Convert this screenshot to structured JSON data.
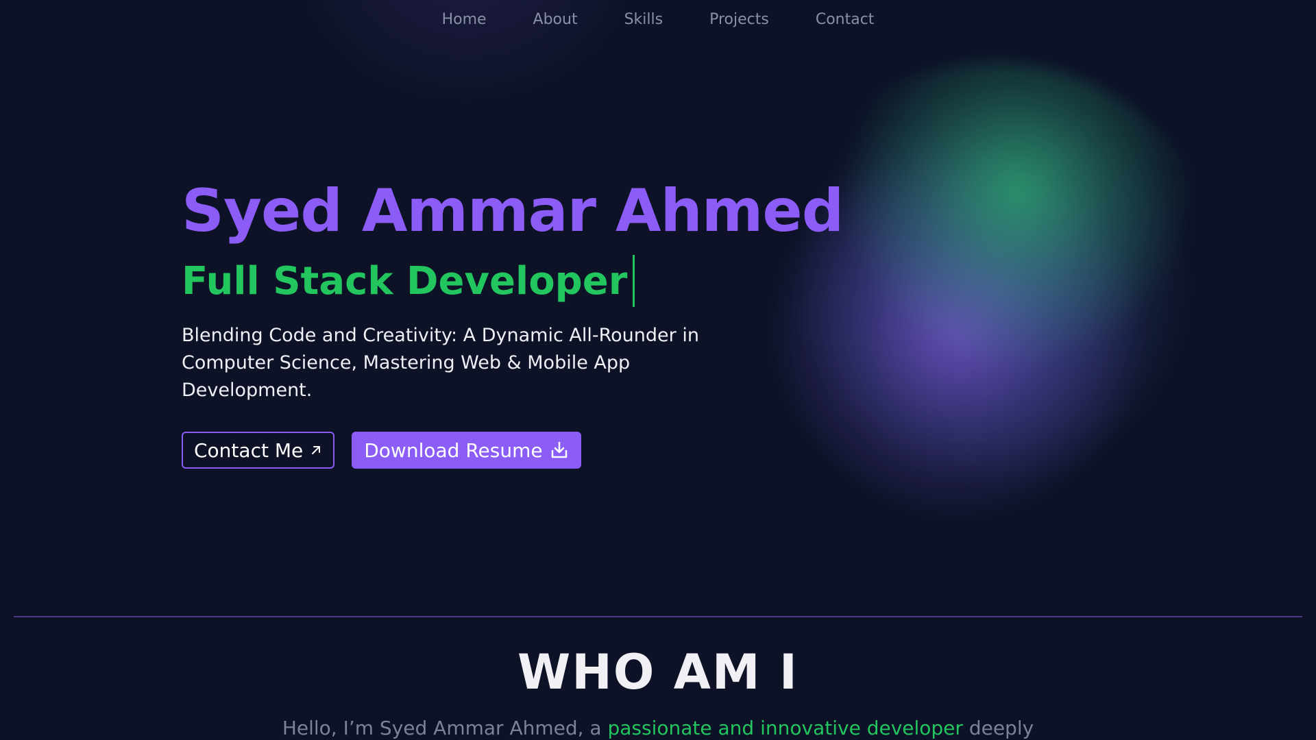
{
  "nav": {
    "items": [
      {
        "label": "Home"
      },
      {
        "label": "About"
      },
      {
        "label": "Skills"
      },
      {
        "label": "Projects"
      },
      {
        "label": "Contact"
      }
    ]
  },
  "hero": {
    "name": "Syed Ammar Ahmed",
    "role": "Full Stack Developer",
    "tagline": "Blending Code and Creativity: A Dynamic All-Rounder in Computer Science, Mastering Web & Mobile App Development.",
    "contact_button": "Contact Me",
    "resume_button": "Download Resume"
  },
  "about": {
    "title": "WHO AM I",
    "intro_prefix": "Hello, I’m Syed Ammar Ahmed, a ",
    "intro_highlight": "passionate and innovative developer",
    "intro_suffix": " deeply"
  },
  "colors": {
    "background": "#0d1227",
    "accent_purple": "#8b5cf6",
    "accent_green": "#22c55e"
  },
  "icons": {
    "contact": "arrow-up-right-icon",
    "resume": "download-icon"
  }
}
